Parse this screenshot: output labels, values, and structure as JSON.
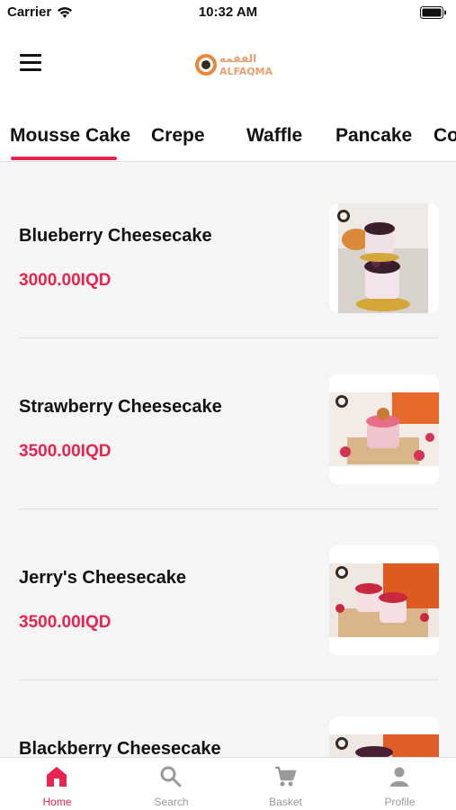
{
  "status_bar": {
    "carrier": "Carrier",
    "time": "10:32 AM"
  },
  "header": {
    "logo_text": "ALFAQMA",
    "logo_arabic": "الفقمه"
  },
  "tabs": [
    {
      "label": "Mousse Cake",
      "active": true
    },
    {
      "label": "Crepe",
      "active": false
    },
    {
      "label": "Waffle",
      "active": false
    },
    {
      "label": "Pancake",
      "active": false
    },
    {
      "label": "Co",
      "active": false
    }
  ],
  "products": [
    {
      "name": "Blueberry Cheesecake",
      "price": "3000.00IQD",
      "image": "blueberry-cheesecake-photo"
    },
    {
      "name": "Strawberry Cheesecake",
      "price": "3500.00IQD",
      "image": "strawberry-cheesecake-photo"
    },
    {
      "name": "Jerry's Cheesecake",
      "price": "3500.00IQD",
      "image": "jerrys-cheesecake-photo"
    },
    {
      "name": "Blackberry Cheesecake",
      "price": "",
      "image": "blackberry-cheesecake-photo"
    }
  ],
  "bottom_nav": [
    {
      "label": "Home",
      "icon": "home-icon",
      "active": true
    },
    {
      "label": "Search",
      "icon": "search-icon",
      "active": false
    },
    {
      "label": "Basket",
      "icon": "cart-icon",
      "active": false
    },
    {
      "label": "Profile",
      "icon": "profile-icon",
      "active": false
    }
  ],
  "colors": {
    "accent": "#e8234f",
    "inactive": "#9a9a9a",
    "background": "#f5f5f5"
  }
}
